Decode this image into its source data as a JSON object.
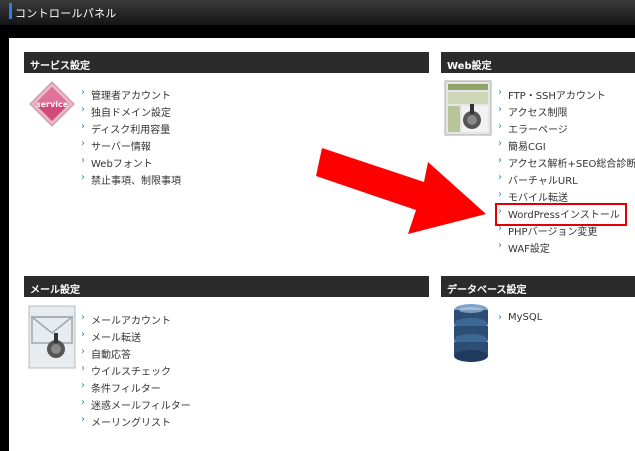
{
  "topbar": {
    "title": "コントロールパネル"
  },
  "sections": {
    "service": {
      "title": "サービス設定",
      "icon_text": "service",
      "items": [
        "管理者アカウント",
        "独自ドメイン設定",
        "ディスク利用容量",
        "サーバー情報",
        "Webフォント",
        "禁止事項、制限事項"
      ]
    },
    "web": {
      "title": "Web設定",
      "items": [
        "FTP・SSHアカウント",
        "アクセス制限",
        "エラーページ",
        "簡易CGI",
        "アクセス解析+SEO総合診断",
        "バーチャルURL",
        "モバイル転送",
        "WordPressインストール",
        "PHPバージョン変更",
        "WAF設定"
      ]
    },
    "mail": {
      "title": "メール設定",
      "items": [
        "メールアカウント",
        "メール転送",
        "自動応答",
        "ウイルスチェック",
        "条件フィルター",
        "迷惑メールフィルター",
        "メーリングリスト"
      ]
    },
    "db": {
      "title": "データベース設定",
      "items": [
        "MySQL"
      ]
    }
  },
  "colors": {
    "highlight": "#e00000",
    "arrow": "#ff0000",
    "chevron": "#3b7fc4",
    "header_bg": "#2b2b2b"
  },
  "icons": {
    "service": "service-diamond-icon",
    "web": "web-browser-icon",
    "mail": "mail-settings-icon",
    "db": "database-icon"
  }
}
